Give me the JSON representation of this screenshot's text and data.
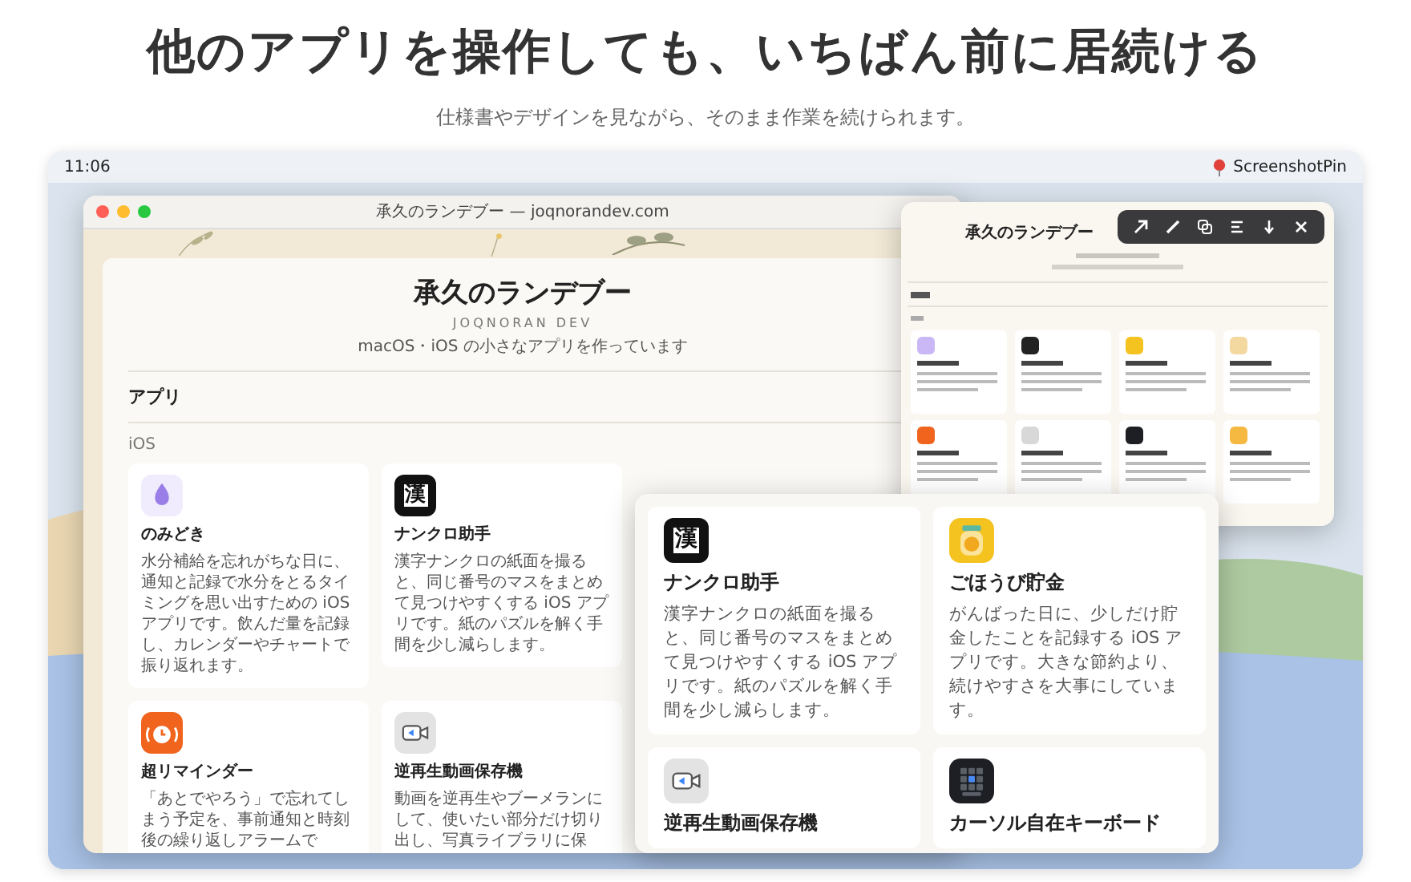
{
  "headline": "他のアプリを操作しても、いちばん前に居続ける",
  "subheadline": "仕様書やデザインを見ながら、そのまま作業を続けられます。",
  "menu_bar": {
    "time": "11:06",
    "app_name": "ScreenshotPin"
  },
  "browser": {
    "title": "承久のランデブー — joqnorandev.com",
    "site_title": "承久のランデブー",
    "site_author": "JOQNORAN DEV",
    "site_tagline": "macOS・iOS の小さなアプリを作っています",
    "section": "アプリ",
    "subsection": "iOS",
    "puzzle_icon_glyph": "漢",
    "apps": [
      {
        "kind": "droplet",
        "name": "のみどき",
        "description": "水分補給を忘れがちな日に、通知と記録で水分をとるタイミングを思い出すための iOS アプリです。飲んだ量を記録し、カレンダーやチャートで振り返れます。"
      },
      {
        "kind": "kanji",
        "name": "ナンクロ助手",
        "description": "漢字ナンクロの紙面を撮ると、同じ番号のマスをまとめて見つけやすくする iOS アプリです。紙のパズルを解く手間を少し減らします。"
      },
      {
        "kind": "alarm",
        "name": "超リマインダー",
        "description": "「あとでやろう」で忘れてしまう予定を、事前通知と時刻後の繰り返しアラームで"
      },
      {
        "kind": "camera",
        "name": "逆再生動画保存機",
        "description": "動画を逆再生やブーメランにして、使いたい部分だけ切り出し、写真ライブラリに保"
      }
    ]
  },
  "pins": [
    {
      "kind": "thumbnail",
      "title": "承久のランデブー"
    },
    {
      "kind": "zoom",
      "puzzle_icon_glyph": "漢",
      "apps": [
        {
          "kind": "kanji",
          "name": "ナンクロ助手",
          "description": "漢字ナンクロの紙面を撮ると、同じ番号のマスをまとめて見つけやすくする iOS アプリです。紙のパズルを解く手間を少し減らします。"
        },
        {
          "kind": "jar",
          "name": "ごほうび貯金",
          "description": "がんばった日に、少しだけ貯金したことを記録する iOS アプリです。大きな節約より、続けやすさを大事にしています。"
        },
        {
          "kind": "camera",
          "name": "逆再生動画保存機"
        },
        {
          "kind": "keyboard",
          "name": "カーソル自在キーボード"
        }
      ]
    }
  ]
}
